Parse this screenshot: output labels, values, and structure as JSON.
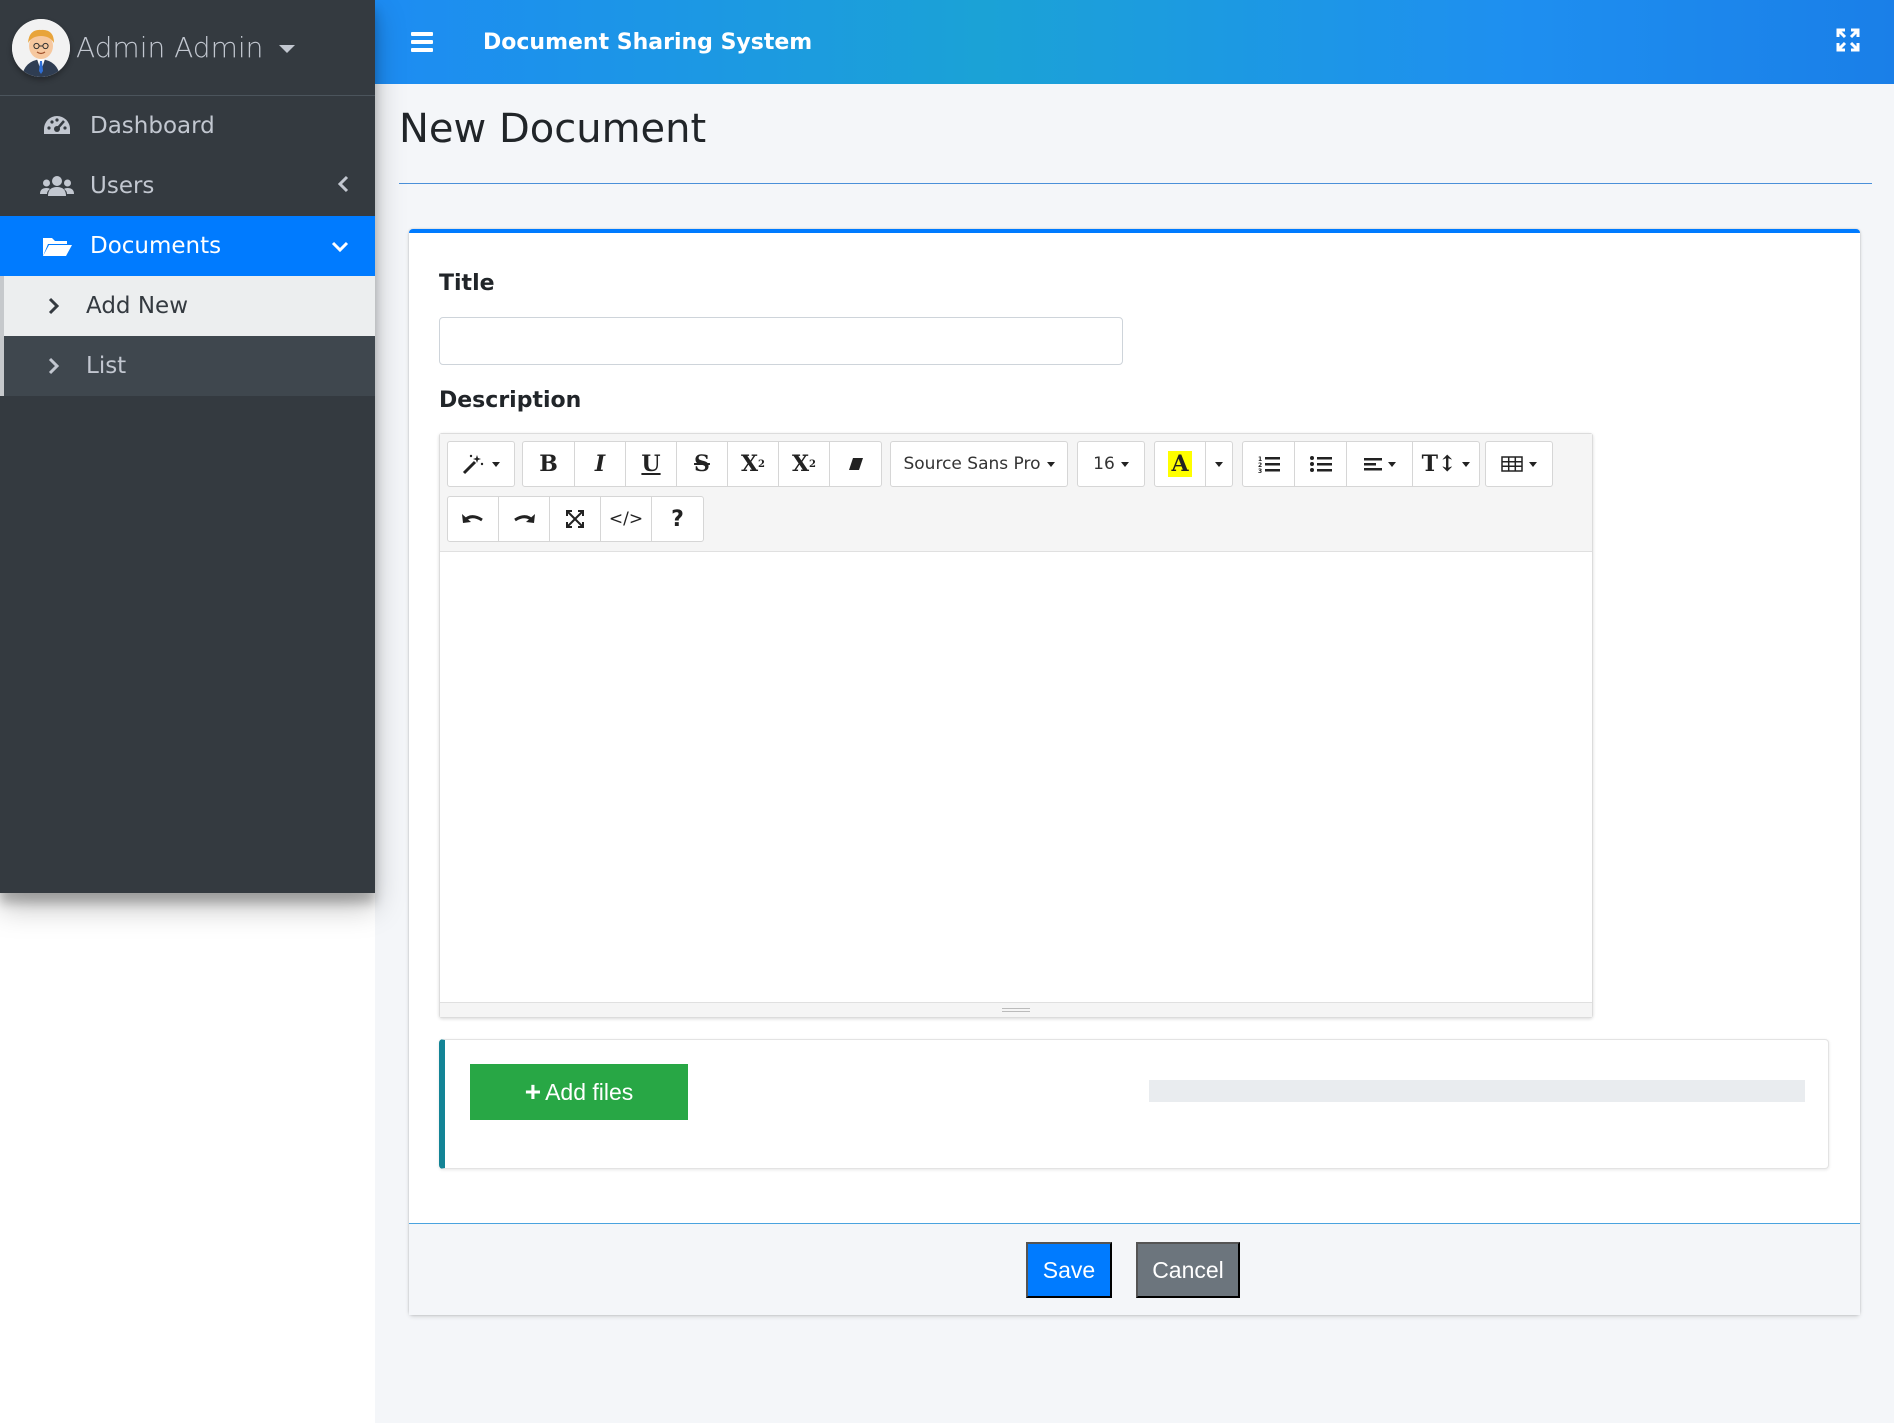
{
  "user": {
    "name": "Admin Admin"
  },
  "sidebar": {
    "items": [
      {
        "label": "Dashboard",
        "icon": "tachometer-icon"
      },
      {
        "label": "Users",
        "icon": "users-icon"
      },
      {
        "label": "Documents",
        "icon": "folder-open-icon",
        "active": true
      }
    ],
    "subitems": [
      {
        "label": "Add New",
        "current": true
      },
      {
        "label": "List"
      }
    ]
  },
  "header": {
    "title": "Document Sharing System"
  },
  "page": {
    "title": "New Document"
  },
  "form": {
    "title_label": "Title",
    "title_value": "",
    "description_label": "Description"
  },
  "editor": {
    "font_name": "Source Sans Pro",
    "font_size": "16",
    "highlight_color": "#ffff00",
    "toolbar_icons": [
      "magic-icon",
      "bold-icon",
      "italic-icon",
      "underline-icon",
      "strikethrough-icon",
      "superscript-icon",
      "subscript-icon",
      "eraser-icon",
      "font-name-dropdown",
      "font-size-dropdown",
      "highlight-color-icon",
      "color-caret-icon",
      "ordered-list-icon",
      "unordered-list-icon",
      "align-icon",
      "line-height-icon",
      "table-icon",
      "undo-icon",
      "redo-icon",
      "fullscreen-icon",
      "code-view-icon",
      "help-icon"
    ]
  },
  "upload": {
    "add_files_label": "Add files",
    "progress": 0
  },
  "actions": {
    "save_label": "Save",
    "cancel_label": "Cancel"
  },
  "colors": {
    "primary": "#007bff",
    "sidebar_bg": "#343a40",
    "success": "#28a745",
    "secondary": "#6c757d",
    "info": "#138496"
  }
}
